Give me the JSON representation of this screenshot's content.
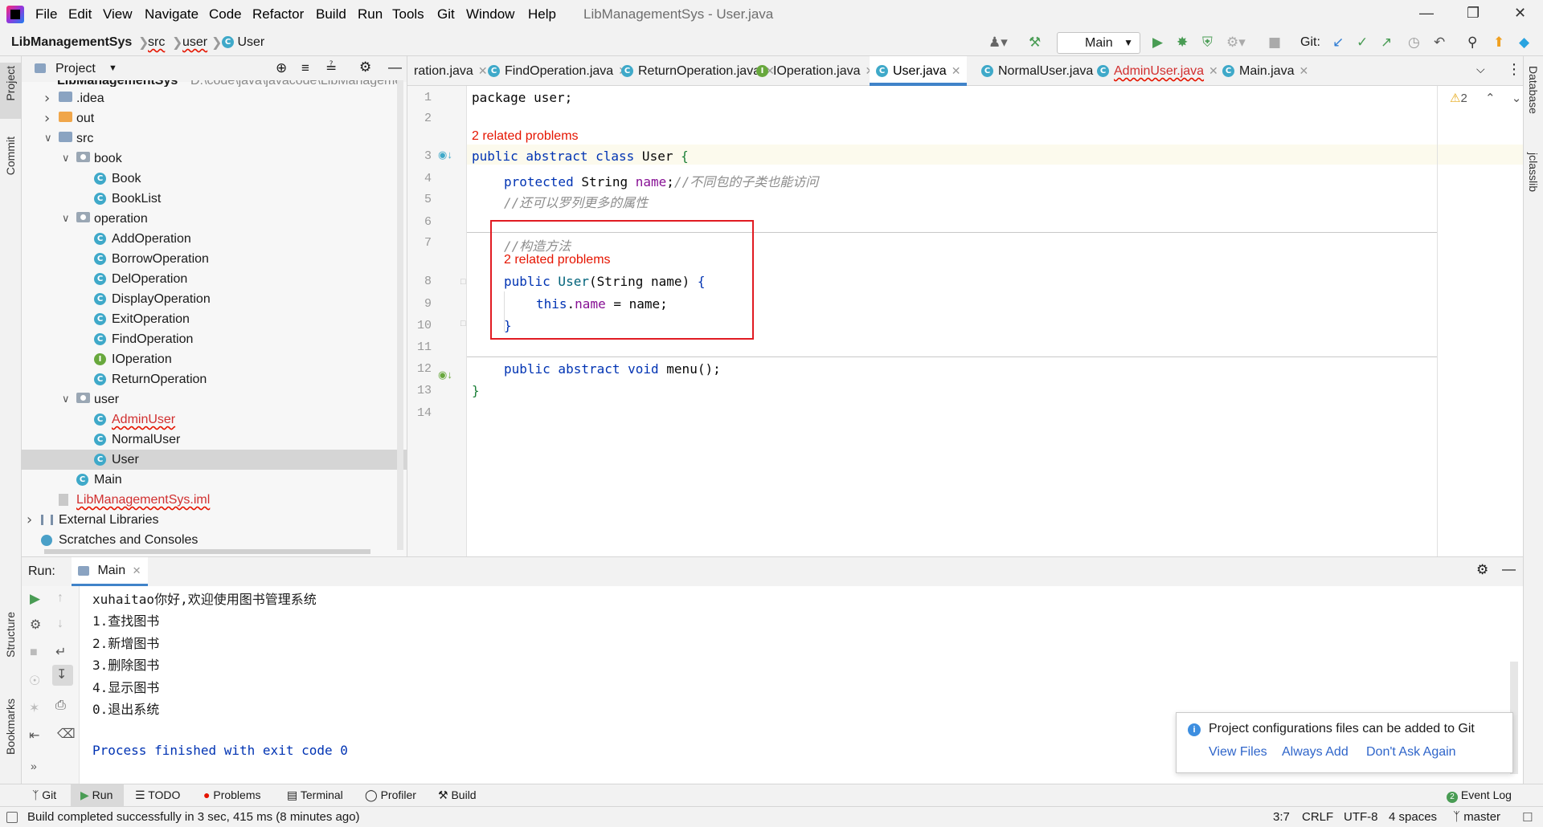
{
  "menu": {
    "items": [
      "File",
      "Edit",
      "View",
      "Navigate",
      "Code",
      "Refactor",
      "Build",
      "Run",
      "Tools",
      "Git",
      "Window",
      "Help"
    ],
    "window_title": "LibManagementSys - User.java"
  },
  "nav": {
    "project": "LibManagementSys",
    "crumbs": [
      "src",
      "user",
      "User"
    ],
    "run_config": "Main",
    "git_label": "Git:"
  },
  "left_stripe": {
    "project": "Project",
    "commit": "Commit",
    "structure": "Structure",
    "bookmarks": "Bookmarks"
  },
  "right_stripe": {
    "database": "Database",
    "jclasslib": "jclasslib"
  },
  "project_panel": {
    "title": "Project",
    "root_name": "LibManagementSys",
    "root_path": "D:\\code\\java\\javacode\\LibManageme",
    "tree": [
      {
        "label": ".idea",
        "depth": 1,
        "kind": "folder",
        "arrow": "right"
      },
      {
        "label": "out",
        "depth": 1,
        "kind": "folder-orange",
        "arrow": "right"
      },
      {
        "label": "src",
        "depth": 1,
        "kind": "folder",
        "arrow": "down"
      },
      {
        "label": "book",
        "depth": 2,
        "kind": "package",
        "arrow": "down"
      },
      {
        "label": "Book",
        "depth": 3,
        "kind": "class"
      },
      {
        "label": "BookList",
        "depth": 3,
        "kind": "class"
      },
      {
        "label": "operation",
        "depth": 2,
        "kind": "package",
        "arrow": "down"
      },
      {
        "label": "AddOperation",
        "depth": 3,
        "kind": "class"
      },
      {
        "label": "BorrowOperation",
        "depth": 3,
        "kind": "class"
      },
      {
        "label": "DelOperation",
        "depth": 3,
        "kind": "class"
      },
      {
        "label": "DisplayOperation",
        "depth": 3,
        "kind": "class"
      },
      {
        "label": "ExitOperation",
        "depth": 3,
        "kind": "class"
      },
      {
        "label": "FindOperation",
        "depth": 3,
        "kind": "class"
      },
      {
        "label": "IOperation",
        "depth": 3,
        "kind": "interface"
      },
      {
        "label": "ReturnOperation",
        "depth": 3,
        "kind": "class"
      },
      {
        "label": "user",
        "depth": 2,
        "kind": "package",
        "arrow": "down"
      },
      {
        "label": "AdminUser",
        "depth": 3,
        "kind": "class",
        "error": true
      },
      {
        "label": "NormalUser",
        "depth": 3,
        "kind": "class"
      },
      {
        "label": "User",
        "depth": 3,
        "kind": "class",
        "selected": true
      },
      {
        "label": "Main",
        "depth": 2,
        "kind": "class-main"
      },
      {
        "label": "LibManagementSys.iml",
        "depth": 1,
        "kind": "file",
        "error": true
      },
      {
        "label": "External Libraries",
        "depth": 0,
        "kind": "libs",
        "arrow": "right"
      },
      {
        "label": "Scratches and Consoles",
        "depth": 0,
        "kind": "scratch"
      }
    ]
  },
  "editor_tabs": [
    {
      "label": "ration.java",
      "icon": "class"
    },
    {
      "label": "FindOperation.java",
      "icon": "class"
    },
    {
      "label": "ReturnOperation.java",
      "icon": "class"
    },
    {
      "label": "IOperation.java",
      "icon": "interface"
    },
    {
      "label": "User.java",
      "icon": "class",
      "active": true
    },
    {
      "label": "NormalUser.java",
      "icon": "class"
    },
    {
      "label": "AdminUser.java",
      "icon": "class",
      "error": true
    },
    {
      "label": "Main.java",
      "icon": "class"
    }
  ],
  "editor": {
    "warning_count": "2",
    "line_numbers": [
      "1",
      "2",
      "3",
      "4",
      "5",
      "6",
      "7",
      "8",
      "9",
      "10",
      "11",
      "12",
      "13",
      "14"
    ],
    "related_problems": "2 related problems",
    "code": {
      "l1": "package user;",
      "l3_kw": "public abstract class",
      "l3_name": " User ",
      "l3_brace": "{",
      "l4_kw": "protected",
      "l4_type": " String ",
      "l4_field": "name",
      "l4_semi": ";",
      "l4_cmt": "//不同包的子类也能访问",
      "l5_cmt": "//还可以罗列更多的属性",
      "l7_cmt": "//构造方法",
      "l8_kw": "public",
      "l8_name": " User",
      "l8_rest": "(String name) ",
      "l8_brace": "{",
      "l9_kw": "this",
      "l9_dot": ".",
      "l9_field": "name",
      "l9_rest": " = name;",
      "l10_brace": "}",
      "l12_kw": "public abstract void",
      "l12_rest": " menu();",
      "l13_brace": "}"
    }
  },
  "run_panel": {
    "label": "Run:",
    "tab": "Main",
    "output": [
      "xuhaitao你好,欢迎使用图书管理系统",
      "1.查找图书",
      "2.新增图书",
      "3.删除图书",
      "4.显示图书",
      "0.退出系统",
      "",
      "Process finished with exit code 0"
    ]
  },
  "notification": {
    "message": "Project configurations files can be added to Git",
    "actions": [
      "View Files",
      "Always Add",
      "Don't Ask Again"
    ]
  },
  "bottom_tools": [
    "Git",
    "Run",
    "TODO",
    "Problems",
    "Terminal",
    "Profiler",
    "Build"
  ],
  "event_log": "Event Log",
  "status": {
    "message": "Build completed successfully in 3 sec, 415 ms (8 minutes ago)",
    "position": "3:7",
    "line_sep": "CRLF",
    "encoding": "UTF-8",
    "indent": "4 spaces",
    "branch": "master"
  },
  "colors": {
    "accent": "#4083c9",
    "error_red": "#e51400",
    "keyword_blue": "#0033b3",
    "field_purple": "#871094",
    "class_icon": "#3fa9c9",
    "run_green": "#499c54"
  }
}
